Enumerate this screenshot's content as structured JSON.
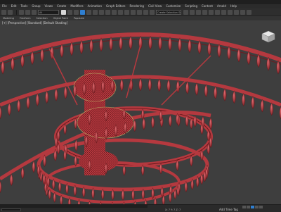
{
  "menu": [
    "File",
    "Edit",
    "Tools",
    "Group",
    "Views",
    "Create",
    "Modifiers",
    "Animation",
    "Graph Editors",
    "Rendering",
    "Civil View",
    "Customize",
    "Scripting",
    "Content",
    "Arnold",
    "Help"
  ],
  "toolbar": {
    "selection_filter": "All",
    "named_selection": "Create Selection Set"
  },
  "ribbon": [
    "Modeling",
    "Freeform",
    "Selection",
    "Object Paint",
    "Populate"
  ],
  "viewport": {
    "label": "[+] [Perspective] [Standard] [Default Shading]",
    "model_color": "#b5393f",
    "background": "#3e3e3e"
  },
  "status": {
    "coords": "X: 7  Y: 7  Z: 7",
    "add_time_tag": "Add Time Tag"
  }
}
